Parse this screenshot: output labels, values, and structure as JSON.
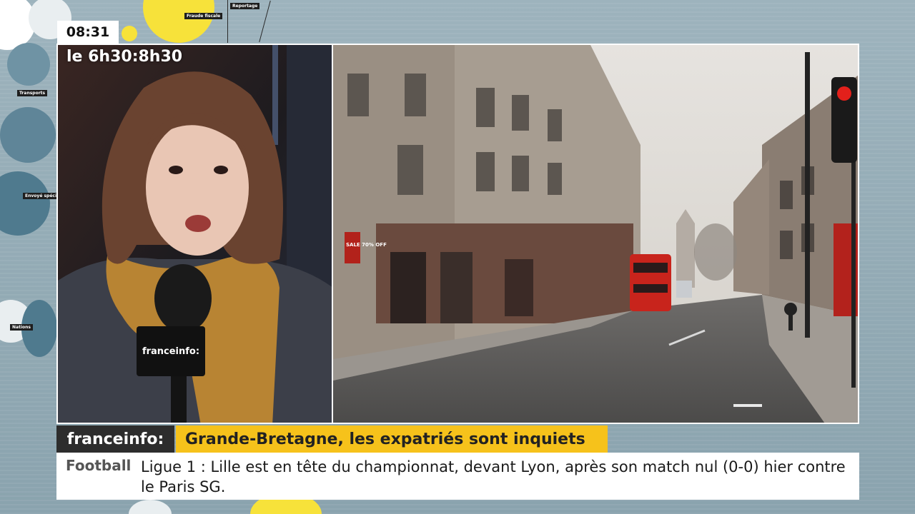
{
  "clock": {
    "time": "08:31"
  },
  "show": {
    "slot": "le 6h30:8h30"
  },
  "mic_logo": "franceinfo:",
  "background_tags": [
    "Reportage",
    "Fraude fiscale",
    "Transports",
    "Envoyé spécial",
    "Nations"
  ],
  "lower_third": {
    "brand": "franceinfo:",
    "headline": "Grande-Bretagne, les expatriés sont inquiets"
  },
  "ticker": {
    "category": "Football",
    "text": "Ligue 1 : Lille est en tête du championnat, devant Lyon, après son match nul (0-0) hier contre le Paris SG."
  },
  "shop_sign": "SALE 70% OFF",
  "colors": {
    "headline_bg": "#f6c21b",
    "brand_bg": "#2d2d2d",
    "ticker_bg": "#ffffff",
    "bus_red": "#c8241c"
  }
}
